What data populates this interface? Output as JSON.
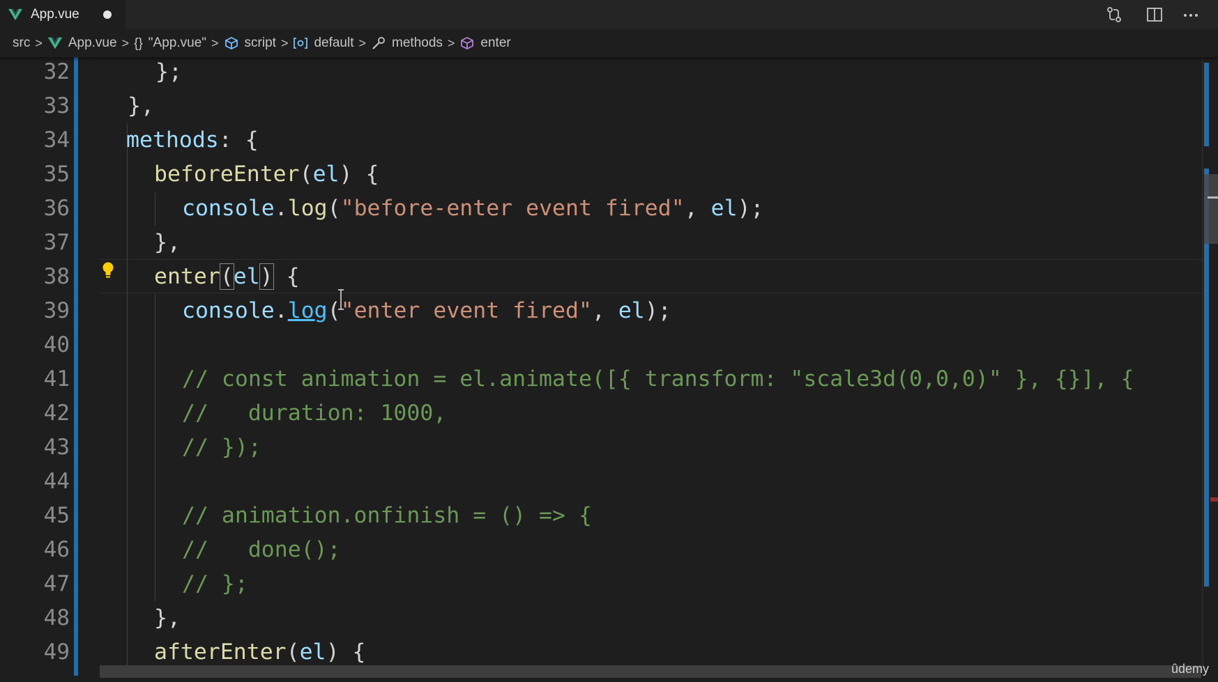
{
  "tab": {
    "filename": "App.vue",
    "dirty": true
  },
  "tabbar_actions": [
    "source-control-compare-icon",
    "split-editor-icon",
    "more-actions-icon"
  ],
  "breadcrumb": {
    "items": [
      "src",
      "App.vue",
      "\"App.vue\"",
      "script",
      "default",
      "methods",
      "enter"
    ],
    "icons": [
      "",
      "vue-icon",
      "braces-icon",
      "cube-icon",
      "namespace-icon",
      "wrench-icon",
      "cube-icon"
    ]
  },
  "line_numbers": [
    "32",
    "33",
    "34",
    "35",
    "36",
    "37",
    "38",
    "39",
    "40",
    "41",
    "42",
    "43",
    "44",
    "45",
    "46",
    "47",
    "48",
    "49"
  ],
  "code": {
    "l32": "};",
    "l33": "},",
    "l34_prop": "methods",
    "l34_rest": ": {",
    "l35_fn": "beforeEnter",
    "l35_p1": "(",
    "l35_arg": "el",
    "l35_p2": ") {",
    "l36_obj": "console",
    "l36_dot": ".",
    "l36_fn": "log",
    "l36_p1": "(",
    "l36_str": "\"before-enter event fired\"",
    "l36_comma": ", ",
    "l36_arg": "el",
    "l36_end": ");",
    "l37": "},",
    "l38_fn": "enter",
    "l38_p1": "(",
    "l38_arg": "el",
    "l38_p2": ")",
    "l38_end": " {",
    "l39_obj": "console",
    "l39_dot": ".",
    "l39_fn": "log",
    "l39_p1": "(",
    "l39_str": "\"enter event fired\"",
    "l39_comma": ", ",
    "l39_arg": "el",
    "l39_end": ");",
    "l41": "// const animation = el.animate([{ transform: \"scale3d(0,0,0)\" }, {}], {",
    "l42": "//   duration: 1000,",
    "l43": "// });",
    "l45": "// animation.onfinish = () => {",
    "l46": "//   done();",
    "l47": "// };",
    "l48": "},",
    "l49_fn": "afterEnter",
    "l49_p1": "(",
    "l49_arg": "el",
    "l49_end": ") {"
  },
  "watermark": "ûdemy",
  "colors": {
    "background": "#1e1e1e",
    "line_number": "#8b8b8b",
    "property": "#9cdcfe",
    "function": "#dcdcaa",
    "string": "#ce9178",
    "comment": "#6a9955",
    "accent_gutter": "#1f6fb3"
  }
}
